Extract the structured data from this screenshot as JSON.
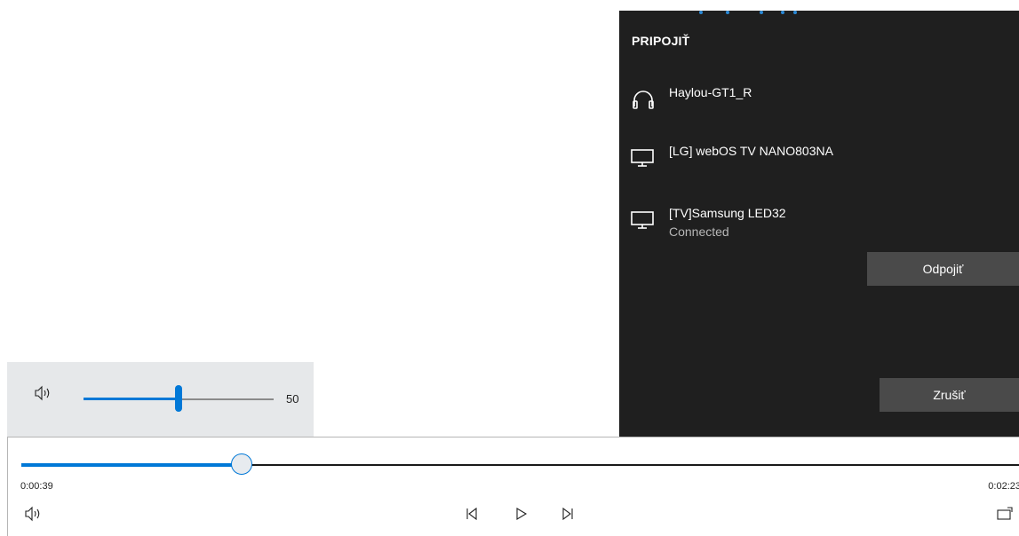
{
  "connect_panel": {
    "title": "PRIPOJIŤ",
    "devices": [
      {
        "name": "Haylou-GT1_R",
        "icon": "headphones-icon",
        "status": ""
      },
      {
        "name": "[LG] webOS TV NANO803NA",
        "icon": "monitor-icon",
        "status": ""
      },
      {
        "name": "[TV]Samsung LED32",
        "icon": "monitor-icon",
        "status": "Connected"
      }
    ],
    "disconnect_label": "Odpojiť",
    "cancel_label": "Zrušiť"
  },
  "volume": {
    "value": "50",
    "level": 0.5,
    "icon": "speaker-icon"
  },
  "player": {
    "elapsed": "0:00:39",
    "total": "0:02:23",
    "progress": 0.27,
    "controls": [
      "speaker-icon",
      "previous-icon",
      "play-icon",
      "next-icon",
      "cast-icon"
    ]
  },
  "colors": {
    "accent": "#0078d7",
    "panel_bg": "#1f1f1f",
    "panel_button": "#4a4a4a",
    "flyout_bg": "#e6e8ea"
  }
}
